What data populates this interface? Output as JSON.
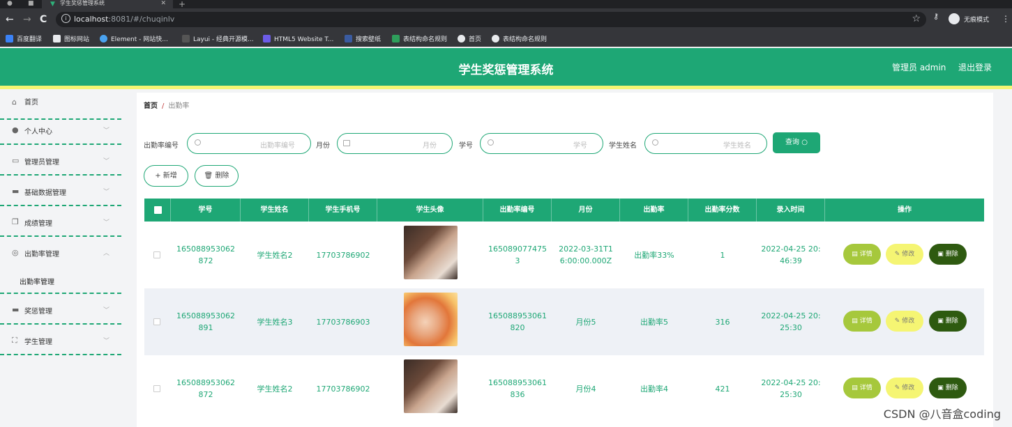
{
  "browser": {
    "tab_title": "学生奖惩管理系统",
    "url_host": "localhost",
    "url_path": ":8081/#/chuqinlv",
    "profile_label": "无痕模式",
    "bookmarks": [
      "百度翻译",
      "图标网站",
      "Element - 网站快...",
      "Layui - 经典开源模...",
      "HTML5 Website T...",
      "搜索壁纸",
      "表结构命名规则",
      "首页",
      "表结构命名规则"
    ]
  },
  "header": {
    "title": "学生奖惩管理系统",
    "user": "管理员 admin",
    "logout": "退出登录"
  },
  "sidebar": {
    "items": [
      {
        "label": "首页",
        "icon": "home-icon"
      },
      {
        "label": "个人中心",
        "icon": "user-icon"
      },
      {
        "label": "管理员管理",
        "icon": "chat-icon"
      },
      {
        "label": "基础数据管理",
        "icon": "message-icon"
      },
      {
        "label": "成绩管理",
        "icon": "copy-icon"
      },
      {
        "label": "出勤率管理",
        "icon": "globe-icon"
      },
      {
        "label": "奖惩管理",
        "icon": "chat-filled-icon"
      },
      {
        "label": "学生管理",
        "icon": "frame-icon"
      }
    ],
    "subitem": "出勤率管理"
  },
  "breadcrumb": {
    "home": "首页",
    "separator": "/",
    "current": "出勤率"
  },
  "filters": {
    "code_label": "出勤率编号",
    "code_placeholder": "出勤率编号",
    "month_label": "月份",
    "month_placeholder": "月份",
    "student_no_label": "学号",
    "student_no_placeholder": "学号",
    "student_name_label": "学生姓名",
    "student_name_placeholder": "学生姓名",
    "query_button": "查询"
  },
  "actions": {
    "add": "+ 新增",
    "delete": "删除"
  },
  "table": {
    "columns": [
      "学号",
      "学生姓名",
      "学生手机号",
      "学生头像",
      "出勤率编号",
      "月份",
      "出勤率",
      "出勤率分数",
      "录入时间",
      "操作"
    ],
    "rows": [
      {
        "student_no": "165088953062872",
        "name": "学生姓名2",
        "phone": "17703786902",
        "code": "1650890774753",
        "month": "2022-03-31T16:00:00.000Z",
        "rate": "出勤率33%",
        "score": "1",
        "time": "2022-04-25 20:46:39"
      },
      {
        "student_no": "165088953062891",
        "name": "学生姓名3",
        "phone": "17703786903",
        "code": "165088953061820",
        "month": "月份5",
        "rate": "出勤率5",
        "score": "316",
        "time": "2022-04-25 20:25:30"
      },
      {
        "student_no": "165088953062872",
        "name": "学生姓名2",
        "phone": "17703786902",
        "code": "165088953061836",
        "month": "月份4",
        "rate": "出勤率4",
        "score": "421",
        "time": "2022-04-25 20:25:30"
      }
    ],
    "row_actions": {
      "detail": "详情",
      "edit": "修改",
      "delete": "删除"
    }
  },
  "watermark": "CSDN @八音盒coding",
  "colors": {
    "primary": "#1ea775",
    "accent_yellow": "#f5f573",
    "detail": "#a6c83c",
    "delete": "#2e5a10"
  }
}
